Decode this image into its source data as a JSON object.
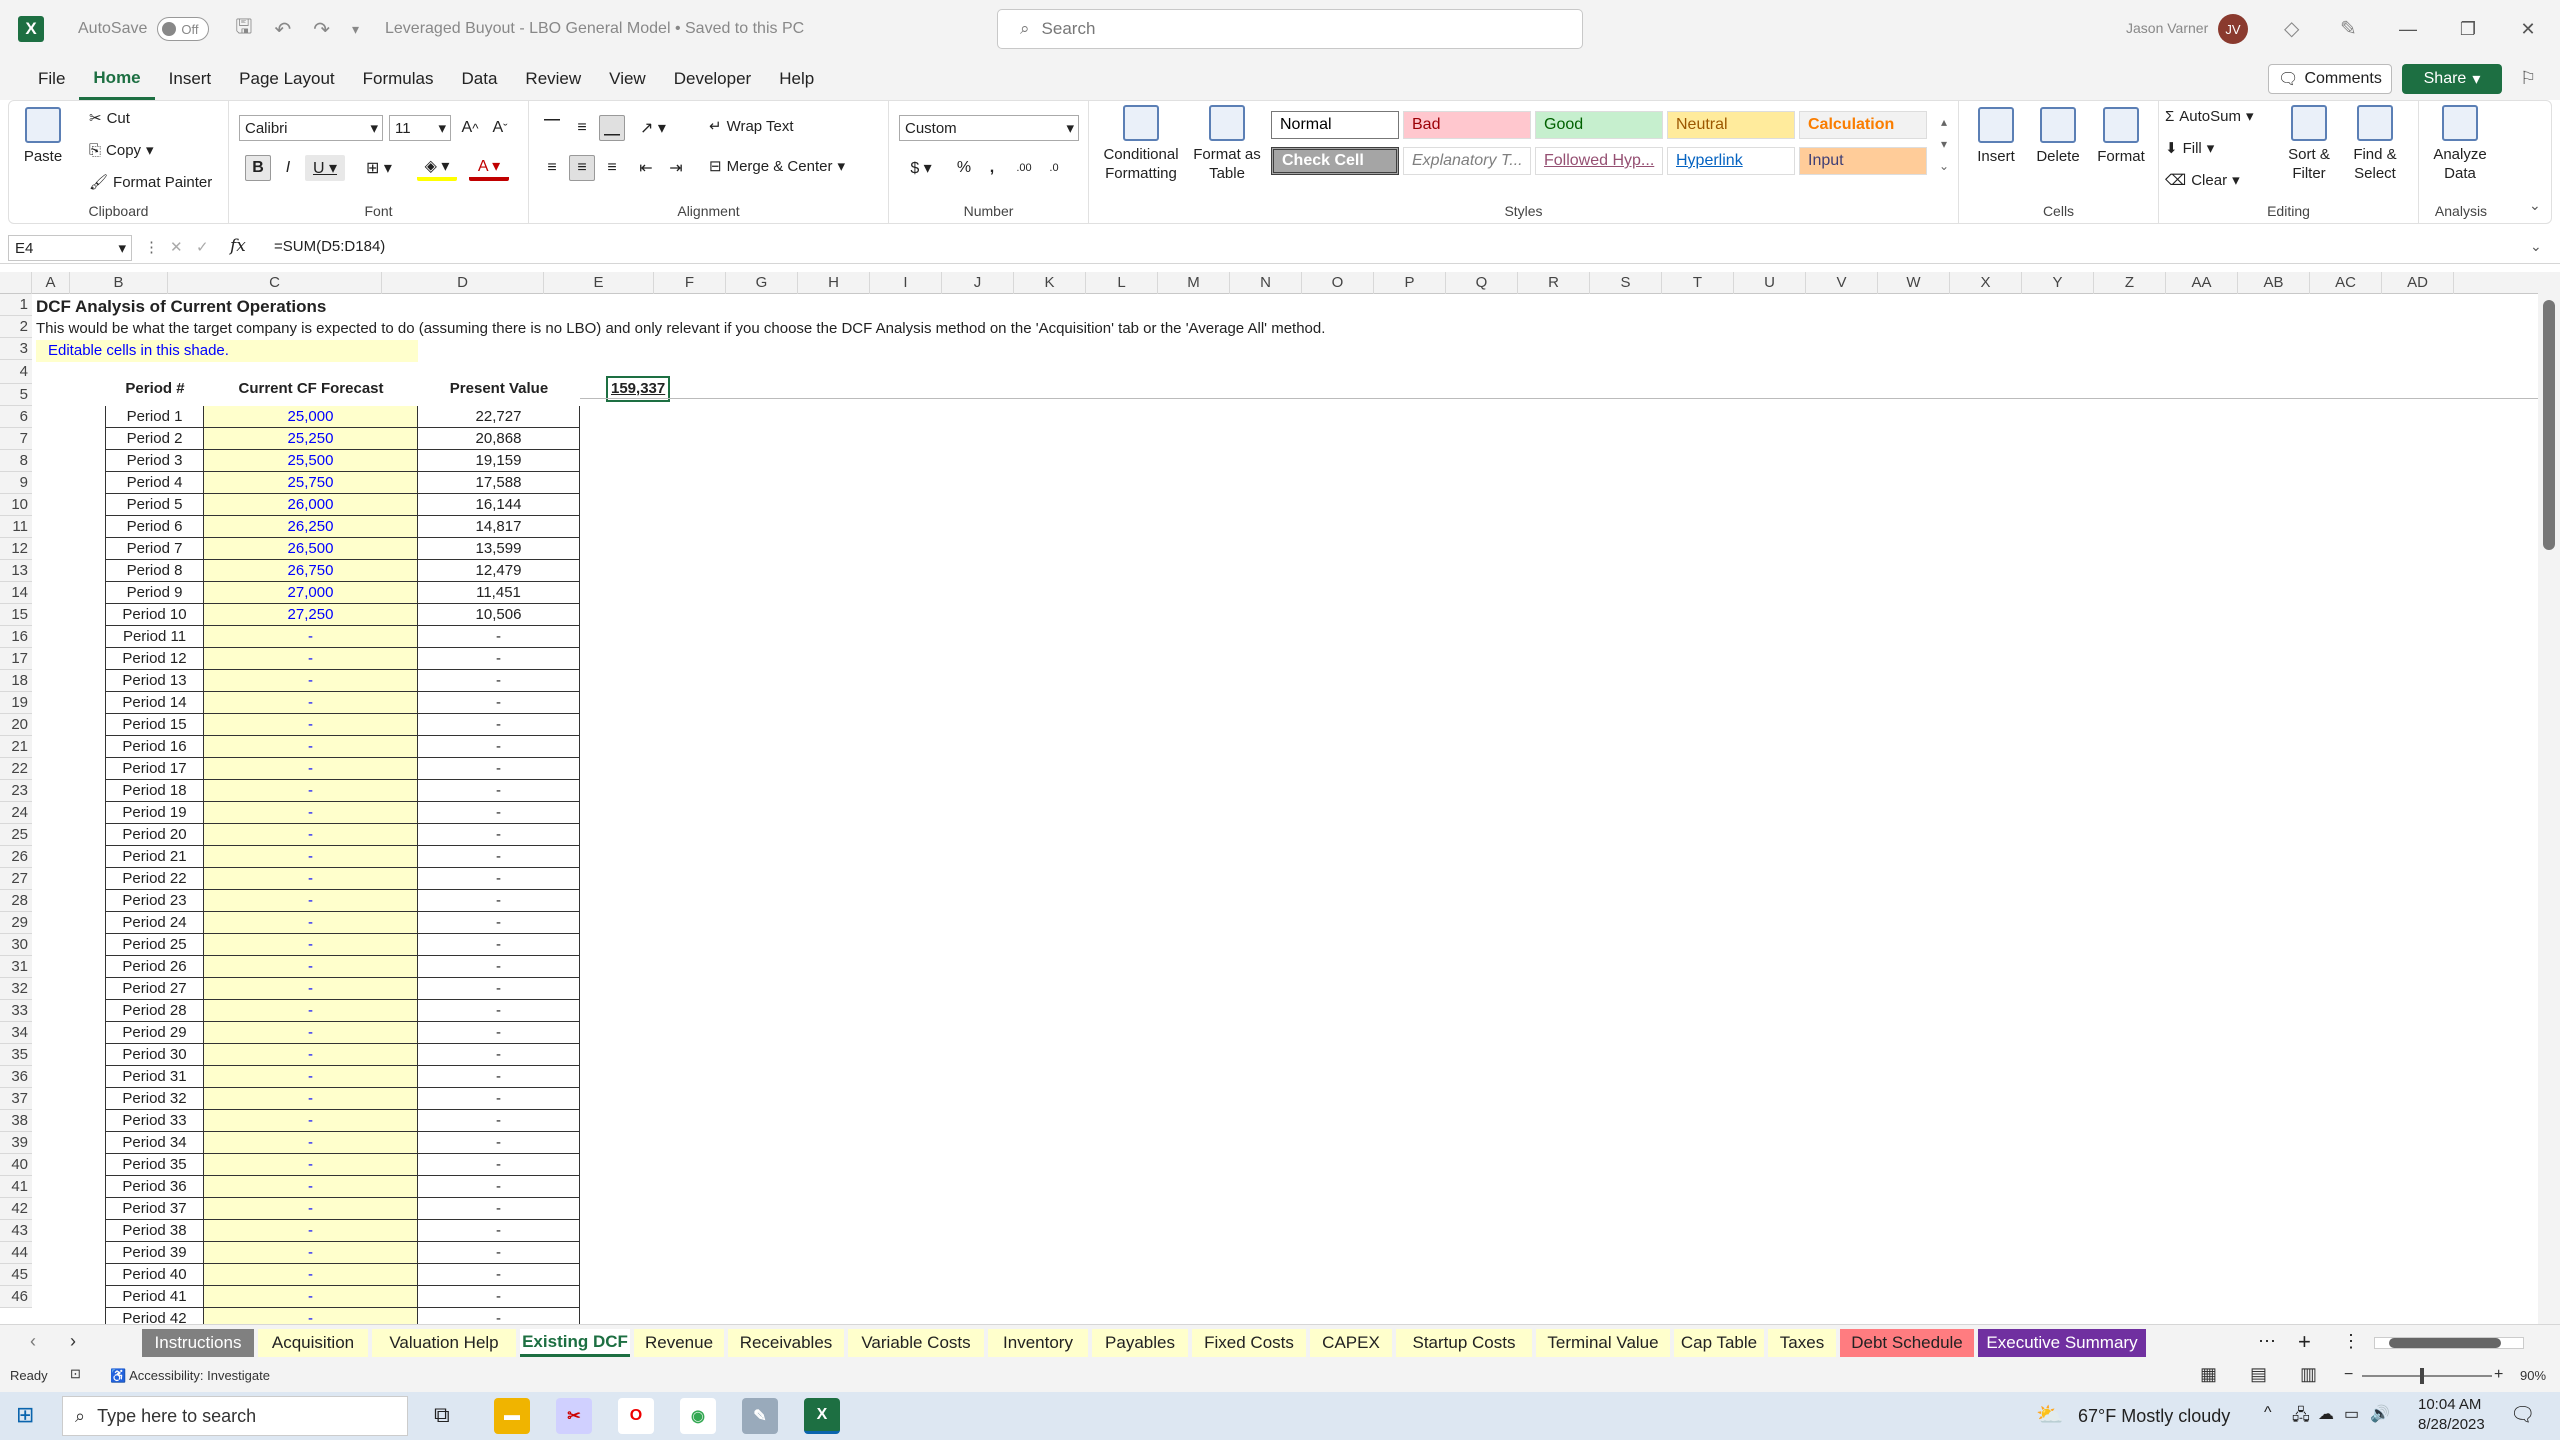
{
  "titlebar": {
    "autosave_label": "AutoSave",
    "autosave_state": "Off",
    "doc_title": "Leveraged Buyout - LBO General Model • Saved to this PC",
    "search_placeholder": "Search",
    "user_name": "Jason Varner",
    "user_initials": "JV"
  },
  "menu": [
    "File",
    "Home",
    "Insert",
    "Page Layout",
    "Formulas",
    "Data",
    "Review",
    "View",
    "Developer",
    "Help"
  ],
  "menu_actions": {
    "comments": "Comments",
    "share": "Share"
  },
  "ribbon": {
    "clipboard": {
      "label": "Clipboard",
      "paste": "Paste",
      "cut": "Cut",
      "copy": "Copy",
      "format_painter": "Format Painter"
    },
    "font": {
      "label": "Font",
      "family": "Calibri",
      "size": "11"
    },
    "alignment": {
      "label": "Alignment",
      "wrap_text": "Wrap Text",
      "merge_center": "Merge & Center"
    },
    "number": {
      "label": "Number",
      "format": "Custom"
    },
    "styles": {
      "label": "Styles",
      "conditional": "Conditional Formatting",
      "format_table": "Format as Table",
      "cells": [
        {
          "name": "Normal",
          "bg": "#ffffff",
          "color": "#000000"
        },
        {
          "name": "Bad",
          "bg": "#ffc7ce",
          "color": "#9c0006"
        },
        {
          "name": "Good",
          "bg": "#c6efce",
          "color": "#006100"
        },
        {
          "name": "Neutral",
          "bg": "#ffeb9c",
          "color": "#9c5700"
        },
        {
          "name": "Calculation",
          "bg": "#f2f2f2",
          "color": "#fa7d00"
        },
        {
          "name": "Check Cell",
          "bg": "#a5a5a5",
          "color": "#ffffff"
        },
        {
          "name": "Explanatory T...",
          "bg": "#ffffff",
          "color": "#7f7f7f"
        },
        {
          "name": "Followed Hyp...",
          "bg": "#ffffff",
          "color": "#954f72"
        },
        {
          "name": "Hyperlink",
          "bg": "#ffffff",
          "color": "#0563c1"
        },
        {
          "name": "Input",
          "bg": "#ffcc99",
          "color": "#3f3f76"
        }
      ]
    },
    "cells": {
      "label": "Cells",
      "insert": "Insert",
      "delete": "Delete",
      "format": "Format"
    },
    "editing": {
      "label": "Editing",
      "autosum": "AutoSum",
      "fill": "Fill",
      "clear": "Clear",
      "sort_filter": "Sort & Filter",
      "find_select": "Find & Select"
    },
    "analysis": {
      "label": "Analysis",
      "analyze_data": "Analyze Data"
    }
  },
  "formula_bar": {
    "name_box": "E4",
    "formula": "=SUM(D5:D184)"
  },
  "columns": [
    "A",
    "B",
    "C",
    "D",
    "E",
    "F",
    "G",
    "H",
    "I",
    "J",
    "K",
    "L",
    "M",
    "N",
    "O",
    "P",
    "Q",
    "R",
    "S",
    "T",
    "U",
    "V",
    "W",
    "X",
    "Y",
    "Z",
    "AA",
    "AB",
    "AC",
    "AD"
  ],
  "sheet": {
    "title": "DCF Analysis of Current Operations",
    "description": "This would be what the target company is expected to do (assuming there is no LBO) and only relevant if you choose the DCF Analysis method on the 'Acquisition' tab or the 'Average All' method.",
    "editable_note": "Editable cells in this shade.",
    "headers": {
      "period": "Period #",
      "forecast": "Current CF Forecast",
      "pv": "Present Value"
    },
    "total_pv": "159,337",
    "rows": [
      {
        "row": 5,
        "period": "Period 1",
        "forecast": "25,000",
        "pv": "22,727"
      },
      {
        "row": 6,
        "period": "Period 2",
        "forecast": "25,250",
        "pv": "20,868"
      },
      {
        "row": 7,
        "period": "Period 3",
        "forecast": "25,500",
        "pv": "19,159"
      },
      {
        "row": 8,
        "period": "Period 4",
        "forecast": "25,750",
        "pv": "17,588"
      },
      {
        "row": 9,
        "period": "Period 5",
        "forecast": "26,000",
        "pv": "16,144"
      },
      {
        "row": 10,
        "period": "Period 6",
        "forecast": "26,250",
        "pv": "14,817"
      },
      {
        "row": 11,
        "period": "Period 7",
        "forecast": "26,500",
        "pv": "13,599"
      },
      {
        "row": 12,
        "period": "Period 8",
        "forecast": "26,750",
        "pv": "12,479"
      },
      {
        "row": 13,
        "period": "Period 9",
        "forecast": "27,000",
        "pv": "11,451"
      },
      {
        "row": 14,
        "period": "Period 10",
        "forecast": "27,250",
        "pv": "10,506"
      },
      {
        "row": 15,
        "period": "Period 11",
        "forecast": "-",
        "pv": "-"
      },
      {
        "row": 16,
        "period": "Period 12",
        "forecast": "-",
        "pv": "-"
      },
      {
        "row": 17,
        "period": "Period 13",
        "forecast": "-",
        "pv": "-"
      },
      {
        "row": 18,
        "period": "Period 14",
        "forecast": "-",
        "pv": "-"
      },
      {
        "row": 19,
        "period": "Period 15",
        "forecast": "-",
        "pv": "-"
      },
      {
        "row": 20,
        "period": "Period 16",
        "forecast": "-",
        "pv": "-"
      },
      {
        "row": 21,
        "period": "Period 17",
        "forecast": "-",
        "pv": "-"
      },
      {
        "row": 22,
        "period": "Period 18",
        "forecast": "-",
        "pv": "-"
      },
      {
        "row": 23,
        "period": "Period 19",
        "forecast": "-",
        "pv": "-"
      },
      {
        "row": 24,
        "period": "Period 20",
        "forecast": "-",
        "pv": "-"
      },
      {
        "row": 25,
        "period": "Period 21",
        "forecast": "-",
        "pv": "-"
      },
      {
        "row": 26,
        "period": "Period 22",
        "forecast": "-",
        "pv": "-"
      },
      {
        "row": 27,
        "period": "Period 23",
        "forecast": "-",
        "pv": "-"
      },
      {
        "row": 28,
        "period": "Period 24",
        "forecast": "-",
        "pv": "-"
      },
      {
        "row": 29,
        "period": "Period 25",
        "forecast": "-",
        "pv": "-"
      },
      {
        "row": 30,
        "period": "Period 26",
        "forecast": "-",
        "pv": "-"
      },
      {
        "row": 31,
        "period": "Period 27",
        "forecast": "-",
        "pv": "-"
      },
      {
        "row": 32,
        "period": "Period 28",
        "forecast": "-",
        "pv": "-"
      },
      {
        "row": 33,
        "period": "Period 29",
        "forecast": "-",
        "pv": "-"
      },
      {
        "row": 34,
        "period": "Period 30",
        "forecast": "-",
        "pv": "-"
      },
      {
        "row": 35,
        "period": "Period 31",
        "forecast": "-",
        "pv": "-"
      },
      {
        "row": 36,
        "period": "Period 32",
        "forecast": "-",
        "pv": "-"
      },
      {
        "row": 37,
        "period": "Period 33",
        "forecast": "-",
        "pv": "-"
      },
      {
        "row": 38,
        "period": "Period 34",
        "forecast": "-",
        "pv": "-"
      },
      {
        "row": 39,
        "period": "Period 35",
        "forecast": "-",
        "pv": "-"
      },
      {
        "row": 40,
        "period": "Period 36",
        "forecast": "-",
        "pv": "-"
      },
      {
        "row": 41,
        "period": "Period 37",
        "forecast": "-",
        "pv": "-"
      },
      {
        "row": 42,
        "period": "Period 38",
        "forecast": "-",
        "pv": "-"
      },
      {
        "row": 43,
        "period": "Period 39",
        "forecast": "-",
        "pv": "-"
      },
      {
        "row": 44,
        "period": "Period 40",
        "forecast": "-",
        "pv": "-"
      },
      {
        "row": 45,
        "period": "Period 41",
        "forecast": "-",
        "pv": "-"
      },
      {
        "row": 46,
        "period": "Period 42",
        "forecast": "-",
        "pv": "-"
      }
    ]
  },
  "sheet_tabs": [
    {
      "name": "Instructions",
      "bg": "#808080",
      "color": "#ffffff"
    },
    {
      "name": "Acquisition",
      "bg": "#ffffcc",
      "color": "#222222"
    },
    {
      "name": "Valuation Help",
      "bg": "#ffffcc",
      "color": "#222222"
    },
    {
      "name": "Existing DCF",
      "bg": "#ffffff",
      "color": "#1d6f42",
      "active": true
    },
    {
      "name": "Revenue",
      "bg": "#ffffcc",
      "color": "#222222"
    },
    {
      "name": "Receivables",
      "bg": "#ffffcc",
      "color": "#222222"
    },
    {
      "name": "Variable Costs",
      "bg": "#ffffcc",
      "color": "#222222"
    },
    {
      "name": "Inventory",
      "bg": "#ffffcc",
      "color": "#222222"
    },
    {
      "name": "Payables",
      "bg": "#ffffcc",
      "color": "#222222"
    },
    {
      "name": "Fixed Costs",
      "bg": "#ffffcc",
      "color": "#222222"
    },
    {
      "name": "CAPEX",
      "bg": "#ffffcc",
      "color": "#222222"
    },
    {
      "name": "Startup Costs",
      "bg": "#ffffcc",
      "color": "#222222"
    },
    {
      "name": "Terminal Value",
      "bg": "#ffffcc",
      "color": "#222222"
    },
    {
      "name": "Cap Table",
      "bg": "#ffffcc",
      "color": "#222222"
    },
    {
      "name": "Taxes",
      "bg": "#ffffcc",
      "color": "#222222"
    },
    {
      "name": "Debt Schedule",
      "bg": "#ff7c80",
      "color": "#222222"
    },
    {
      "name": "Executive Summary",
      "bg": "#7030a0",
      "color": "#ffffff"
    }
  ],
  "status": {
    "ready": "Ready",
    "accessibility": "Accessibility: Investigate",
    "zoom": "90%"
  },
  "taskbar": {
    "search_placeholder": "Type here to search",
    "weather": "67°F  Mostly cloudy",
    "time": "10:04 AM",
    "date": "8/28/2023"
  }
}
